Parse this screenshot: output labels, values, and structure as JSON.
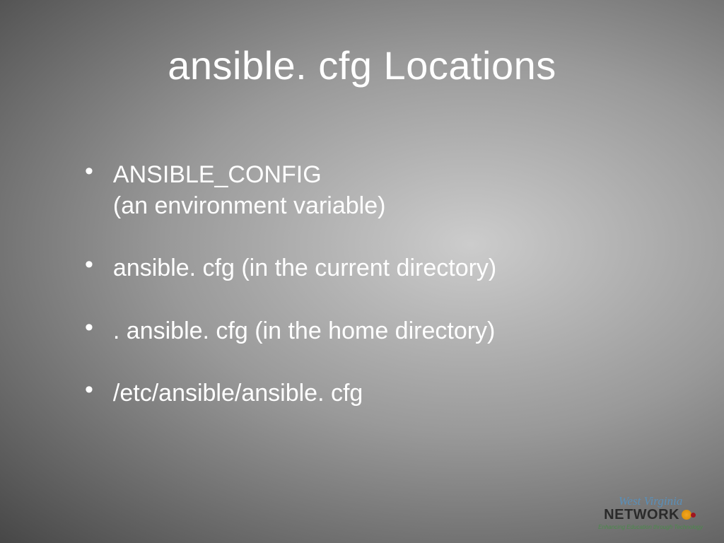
{
  "slide": {
    "title": "ansible. cfg Locations",
    "bullets": [
      {
        "line1": "ANSIBLE_CONFIG",
        "line2": "(an environment variable)"
      },
      {
        "line1": "ansible. cfg (in the current directory)"
      },
      {
        "line1": ". ansible. cfg (in the home directory)"
      },
      {
        "line1": "/etc/ansible/ansible. cfg"
      }
    ]
  },
  "logo": {
    "top": "West Virginia",
    "main": "NETWORK",
    "tagline": "Enhancing Education through Technology"
  }
}
